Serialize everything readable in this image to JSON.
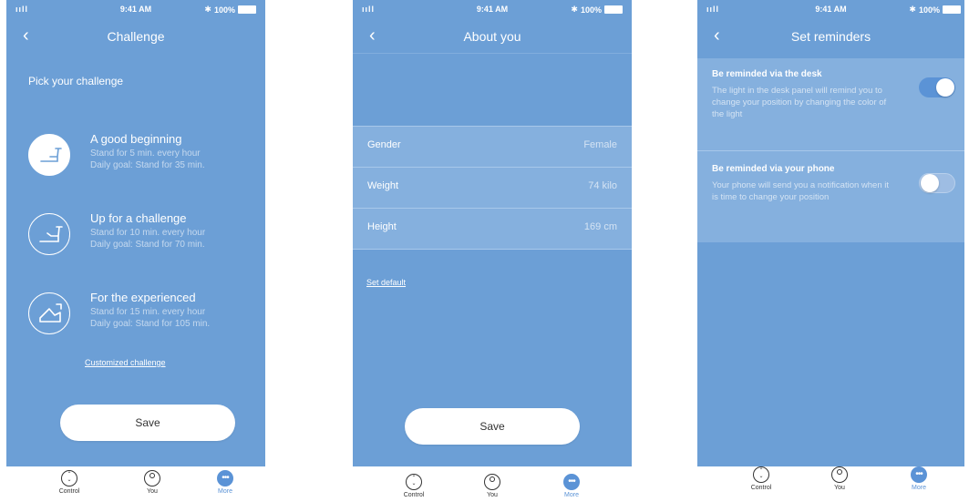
{
  "status": {
    "signal": "ııll",
    "time": "9:41 AM",
    "bluetooth": "✱",
    "battery": "100%"
  },
  "tabs": [
    {
      "label": "Control",
      "icon": "control-icon"
    },
    {
      "label": "You",
      "icon": "person-icon"
    },
    {
      "label": "More",
      "icon": "more-icon"
    }
  ],
  "colors": {
    "background": "#6c9fd6",
    "row": "#85b0de",
    "accent": "#5b93d6"
  },
  "screen1": {
    "title": "Challenge",
    "heading": "Pick your challenge",
    "challenges": [
      {
        "name": "A good beginning",
        "line1": "Stand for 5 min. every hour",
        "line2": "Daily goal: Stand for 35 min.",
        "selected": true
      },
      {
        "name": "Up for a challenge",
        "line1": "Stand for 10 min. every hour",
        "line2": "Daily goal: Stand for 70 min.",
        "selected": false
      },
      {
        "name": "For the experienced",
        "line1": "Stand for 15 min. every hour",
        "line2": "Daily goal: Stand for 105 min.",
        "selected": false
      }
    ],
    "custom_link": "Customized challenge",
    "save_label": "Save"
  },
  "screen2": {
    "title": "About you",
    "rows": [
      {
        "label": "Gender",
        "value": "Female"
      },
      {
        "label": "Weight",
        "value": "74 kilo"
      },
      {
        "label": "Height",
        "value": "169 cm"
      }
    ],
    "default_link": "Set default",
    "save_label": "Save"
  },
  "screen3": {
    "title": "Set reminders",
    "reminders": [
      {
        "heading": "Be reminded via the desk",
        "desc": "The light in the desk panel will remind you to change your position by changing the color of the light",
        "on": true
      },
      {
        "heading": "Be reminded via your phone",
        "desc": "Your phone will send you a notification when it is time to change your position",
        "on": false
      }
    ]
  }
}
